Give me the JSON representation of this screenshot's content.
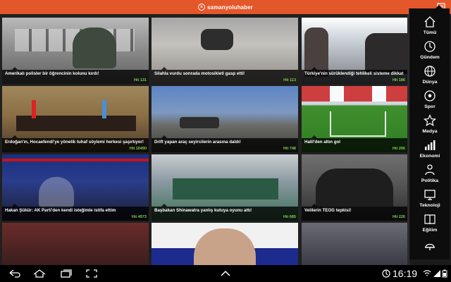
{
  "app": {
    "logo_text": "samanyoluhaber",
    "logo_mark": "s"
  },
  "news": [
    {
      "title": "Amerikalı polisler bir öğrencinin kolunu kırdı!",
      "hits": "Hit 131"
    },
    {
      "title": "Silahla vurdu sonrada motosikleti gasp etti!",
      "hits": "Hit 113"
    },
    {
      "title": "Türkiye'nin sürüklendiği tehlikeli sisteme dikkat çekti!",
      "hits": "Hit 186"
    },
    {
      "title": "Erdoğan'ın, Hocaefendi'ye yönelik tuhaf söylemi herkesi şaşırtıyor!",
      "hits": "Hit 10490"
    },
    {
      "title": "Drift yapan araç seyircilerin arasına daldı!",
      "hits": "Hit 748"
    },
    {
      "title": "Halil'den altın gol",
      "hits": "Hit 206"
    },
    {
      "title": "Hakan Şükür: AK Parti'den kendi isteğimle istifa ettim",
      "hits": "Hit 4973"
    },
    {
      "title": "Başbakan Shinawatra yanlış kutuya oyunu attı!",
      "hits": "Hit 685"
    },
    {
      "title": "Velilerin TEOG tepkisi!",
      "hits": "Hit 226"
    },
    {
      "title": "",
      "hits": ""
    },
    {
      "title": "",
      "hits": ""
    },
    {
      "title": "",
      "hits": ""
    }
  ],
  "menu": [
    {
      "label": "Tümü",
      "icon": "home-icon"
    },
    {
      "label": "Gündem",
      "icon": "clock-icon"
    },
    {
      "label": "Dünya",
      "icon": "globe-icon"
    },
    {
      "label": "Spor",
      "icon": "soccer-ball-icon"
    },
    {
      "label": "Medya",
      "icon": "star-icon"
    },
    {
      "label": "Ekonomi",
      "icon": "bar-chart-icon"
    },
    {
      "label": "Politika",
      "icon": "person-icon"
    },
    {
      "label": "Teknoloji",
      "icon": "monitor-icon"
    },
    {
      "label": "Eğitim",
      "icon": "book-icon"
    },
    {
      "label": "",
      "icon": "helmet-icon"
    }
  ],
  "status": {
    "time": "16:19"
  },
  "colors": {
    "brand": "#e4572a",
    "hit": "#7dd04a",
    "menu_bg": "#0d0d0d"
  }
}
